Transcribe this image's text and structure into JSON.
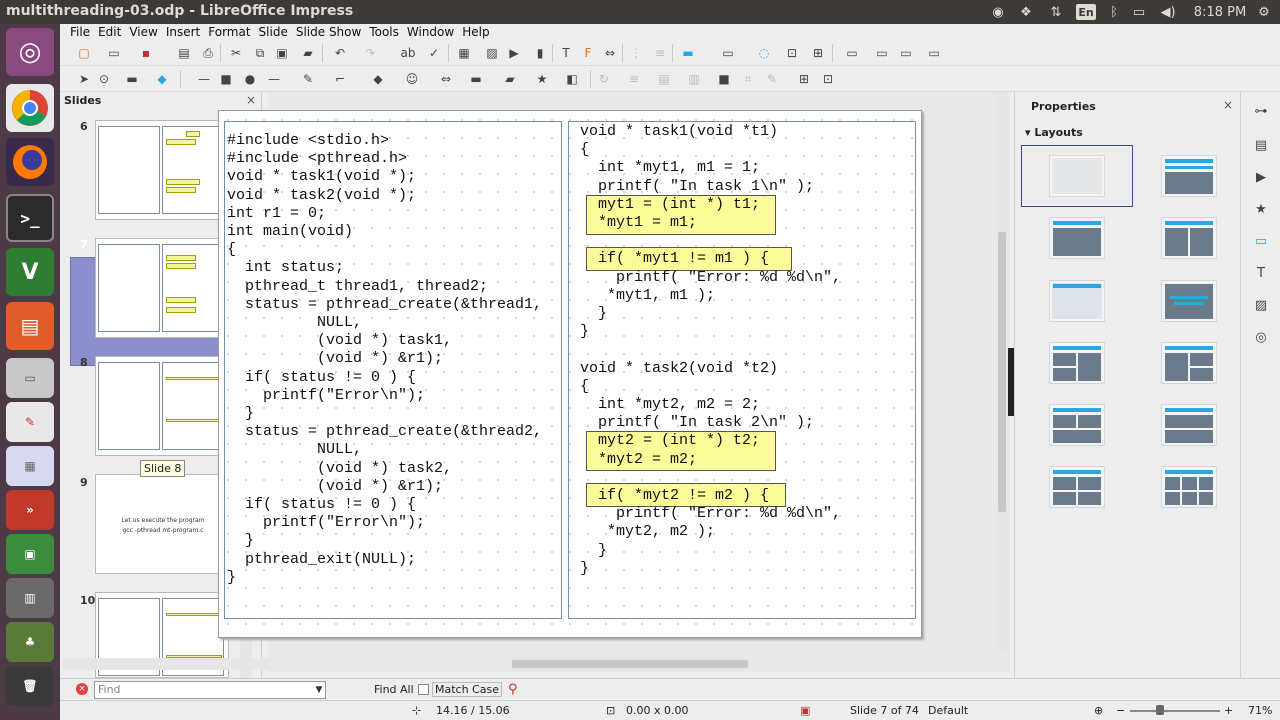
{
  "topbar": {
    "window_title": "multithreading-03.odp - LibreOffice Impress",
    "keyboard": "En",
    "clock": "8:18 PM"
  },
  "menu": [
    "File",
    "Edit",
    "View",
    "Insert",
    "Format",
    "Slide",
    "Slide Show",
    "Tools",
    "Window",
    "Help"
  ],
  "slides_pane": {
    "title": "Slides",
    "close": "×",
    "slide_numbers": [
      "6",
      "7",
      "8",
      "9",
      "10"
    ],
    "slide9_text": [
      "Let us execute the program",
      "gcc -pthread mt-program.c"
    ],
    "tooltip": "Slide 8",
    "selected": "7"
  },
  "slide": {
    "left_code": [
      "#include <stdio.h>",
      "#include <pthread.h>",
      "void * task1(void *);",
      "void * task2(void *);",
      "int r1 = 0;",
      "int main(void)",
      "{",
      "  int status;",
      "  pthread_t thread1, thread2;",
      "  status = pthread_create(&thread1,",
      "          NULL,",
      "          (void *) task1,",
      "          (void *) &r1);",
      "  if( status != 0 ) {",
      "    printf(\"Error\\n\");",
      "  }",
      "  status = pthread_create(&thread2,",
      "          NULL,",
      "          (void *) task2,",
      "          (void *) &r1);",
      "  if( status != 0 ) {",
      "    printf(\"Error\\n\");",
      "  }",
      "  pthread_exit(NULL);",
      "}"
    ],
    "right_code": [
      "void * task1(void *t1)",
      "{",
      "  int *myt1, m1 = 1;",
      "  printf( \"In task 1\\n\" );",
      "  myt1 = (int *) t1;",
      "  *myt1 = m1;",
      "",
      "  if( *myt1 != m1 ) {",
      "    printf( \"Error: %d %d\\n\",",
      "   *myt1, m1 );",
      "  }",
      "}",
      "",
      "void * task2(void *t2)",
      "{",
      "  int *myt2, m2 = 2;",
      "  printf( \"In task 2\\n\" );",
      "  myt2 = (int *) t2;",
      "  *myt2 = m2;",
      "",
      "  if( *myt2 != m2 ) {",
      "    printf( \"Error: %d %d\\n\",",
      "   *myt2, m2 );",
      "  }",
      "}"
    ]
  },
  "properties": {
    "title": "Properties",
    "close": "×",
    "section": "Layouts"
  },
  "findbar": {
    "placeholder": "Find",
    "find_all": "Find All",
    "match_case": "Match Case"
  },
  "statusbar": {
    "position": "14.16 / 15.06",
    "size": "0.00 x 0.00",
    "slide": "Slide 7 of 74",
    "master": "Default",
    "zoom": "71%"
  }
}
